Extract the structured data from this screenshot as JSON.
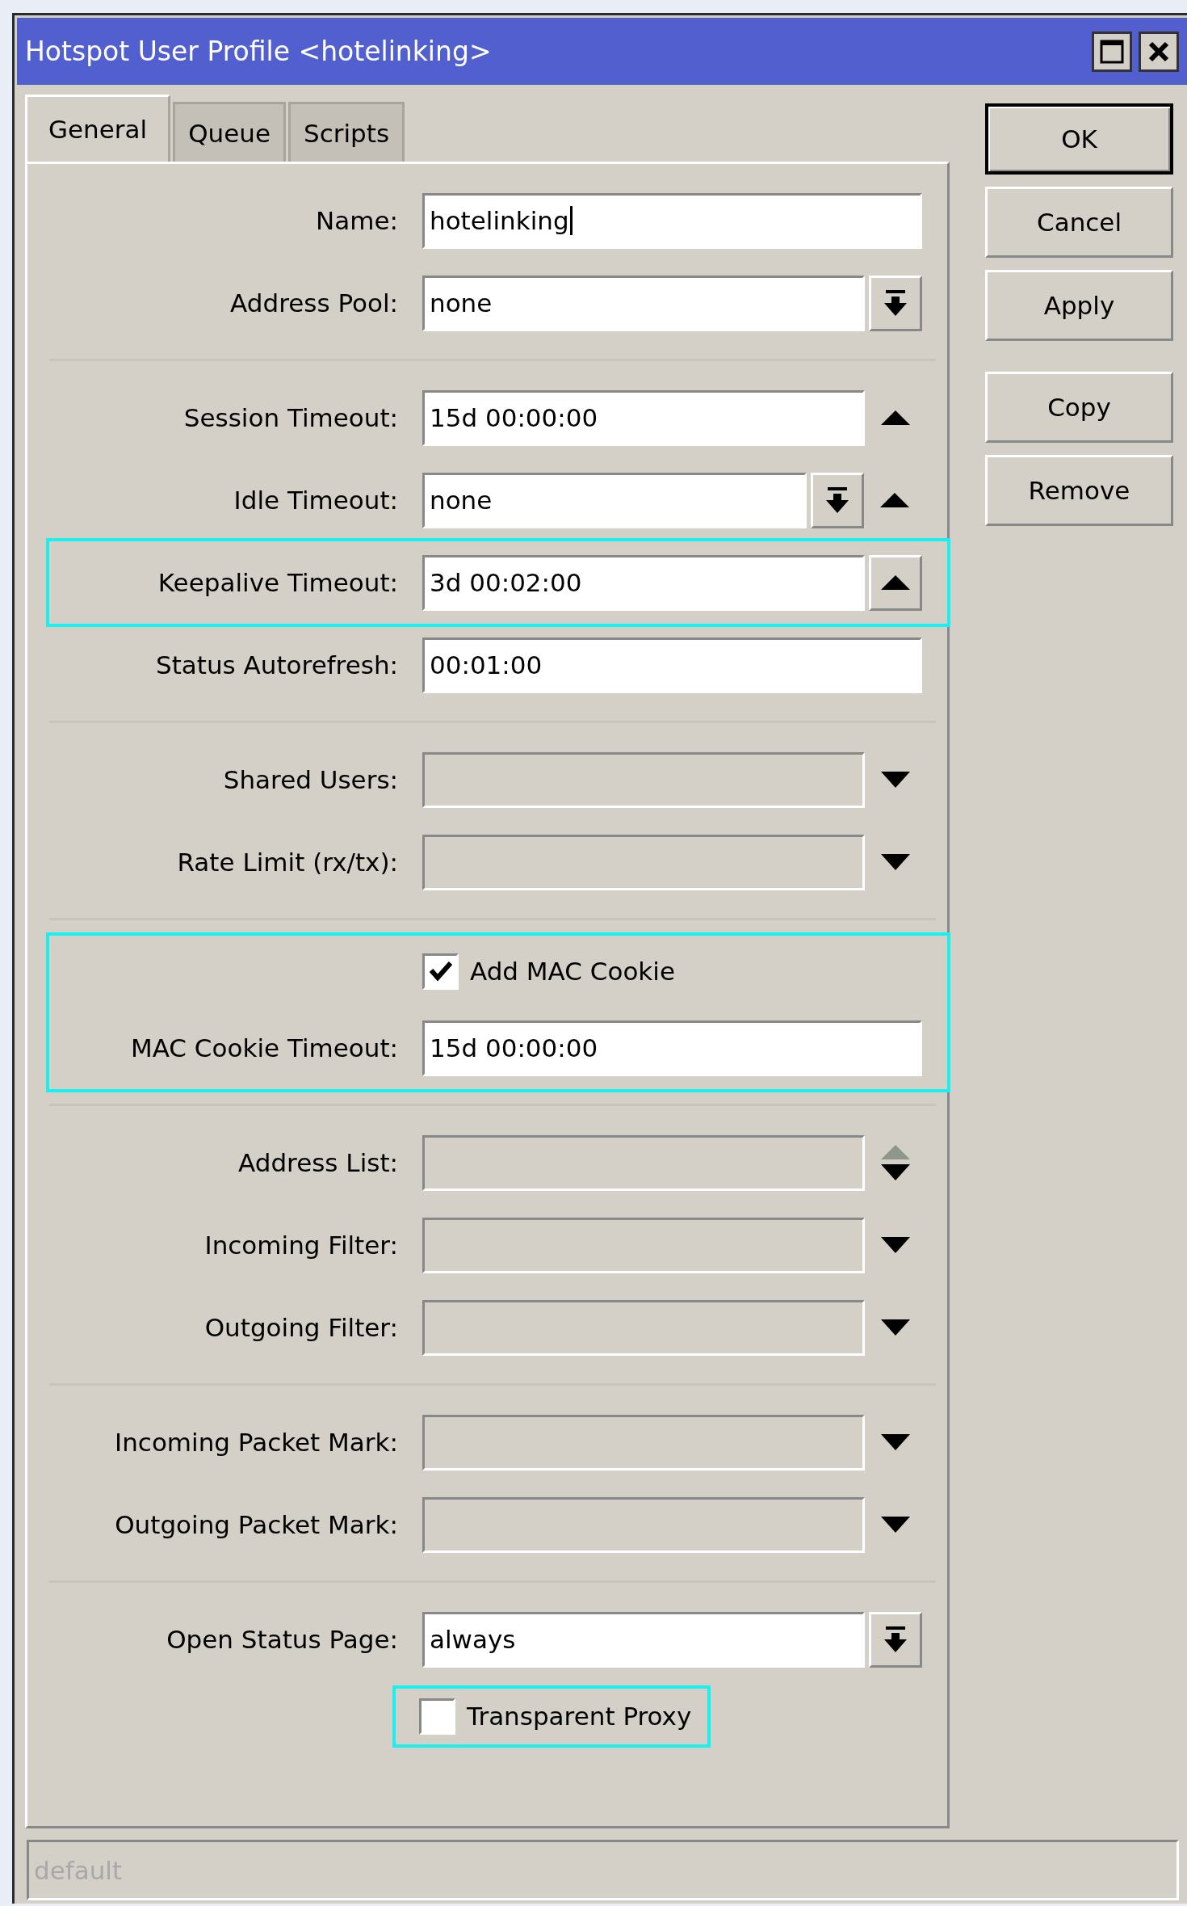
{
  "window": {
    "title": "Hotspot User Profile <hotelinking>"
  },
  "tabs": [
    {
      "label": "General",
      "selected": true
    },
    {
      "label": "Queue",
      "selected": false
    },
    {
      "label": "Scripts",
      "selected": false
    }
  ],
  "sections": [
    {
      "rows": [
        {
          "label": "Name:",
          "value": "hotelinking",
          "kind": "text",
          "focused": true,
          "highlighted": false
        },
        {
          "label": "Address Pool:",
          "value": "none",
          "kind": "select",
          "focused": false,
          "highlighted": false
        }
      ]
    },
    {
      "rows": [
        {
          "label": "Session Timeout:",
          "value": "15d 00:00:00",
          "kind": "text_spin",
          "focused": false,
          "highlighted": false
        },
        {
          "label": "Idle Timeout:",
          "value": "none",
          "kind": "select_spin",
          "focused": false,
          "highlighted": false
        },
        {
          "label": "Keepalive Timeout:",
          "value": "3d 00:02:00",
          "kind": "text_spin_button",
          "focused": false,
          "highlighted": true
        },
        {
          "label": "Status Autorefresh:",
          "value": "00:01:00",
          "kind": "text",
          "focused": false,
          "highlighted": false
        }
      ]
    },
    {
      "rows": [
        {
          "label": "Shared Users:",
          "kind": "empty_list",
          "focused": false,
          "highlighted": false
        },
        {
          "label": "Rate Limit (rx/tx):",
          "kind": "empty_list",
          "focused": false,
          "highlighted": false
        }
      ]
    },
    {
      "rows": [
        {
          "label": "Add MAC Cookie",
          "kind": "checkbox",
          "checked": true,
          "highlighted": true
        },
        {
          "label": "MAC Cookie Timeout:",
          "value": "15d 00:00:00",
          "kind": "text",
          "focused": false,
          "highlighted": true
        }
      ]
    },
    {
      "rows": [
        {
          "label": "Address List:",
          "kind": "empty_list_spin",
          "focused": false,
          "highlighted": false
        },
        {
          "label": "Incoming Filter:",
          "kind": "empty_list",
          "focused": false,
          "highlighted": false
        },
        {
          "label": "Outgoing Filter:",
          "kind": "empty_list",
          "focused": false,
          "highlighted": false
        }
      ]
    },
    {
      "rows": [
        {
          "label": "Incoming Packet Mark:",
          "kind": "empty_list",
          "focused": false,
          "highlighted": false
        },
        {
          "label": "Outgoing Packet Mark:",
          "kind": "empty_list",
          "focused": false,
          "highlighted": false
        }
      ]
    },
    {
      "rows": [
        {
          "label": "Open Status Page:",
          "value": "always",
          "kind": "select",
          "focused": false,
          "highlighted": false
        },
        {
          "label": "Transparent Proxy",
          "kind": "checkbox",
          "checked": false,
          "highlighted": true
        }
      ]
    }
  ],
  "button_groups": [
    {
      "buttons": [
        {
          "label": "OK",
          "default": true
        },
        {
          "label": "Cancel",
          "default": false
        },
        {
          "label": "Apply",
          "default": false
        }
      ]
    },
    {
      "buttons": [
        {
          "label": "Copy",
          "default": false
        },
        {
          "label": "Remove",
          "default": false
        }
      ]
    }
  ],
  "status_bar": {
    "text": "default",
    "disabled": true
  }
}
